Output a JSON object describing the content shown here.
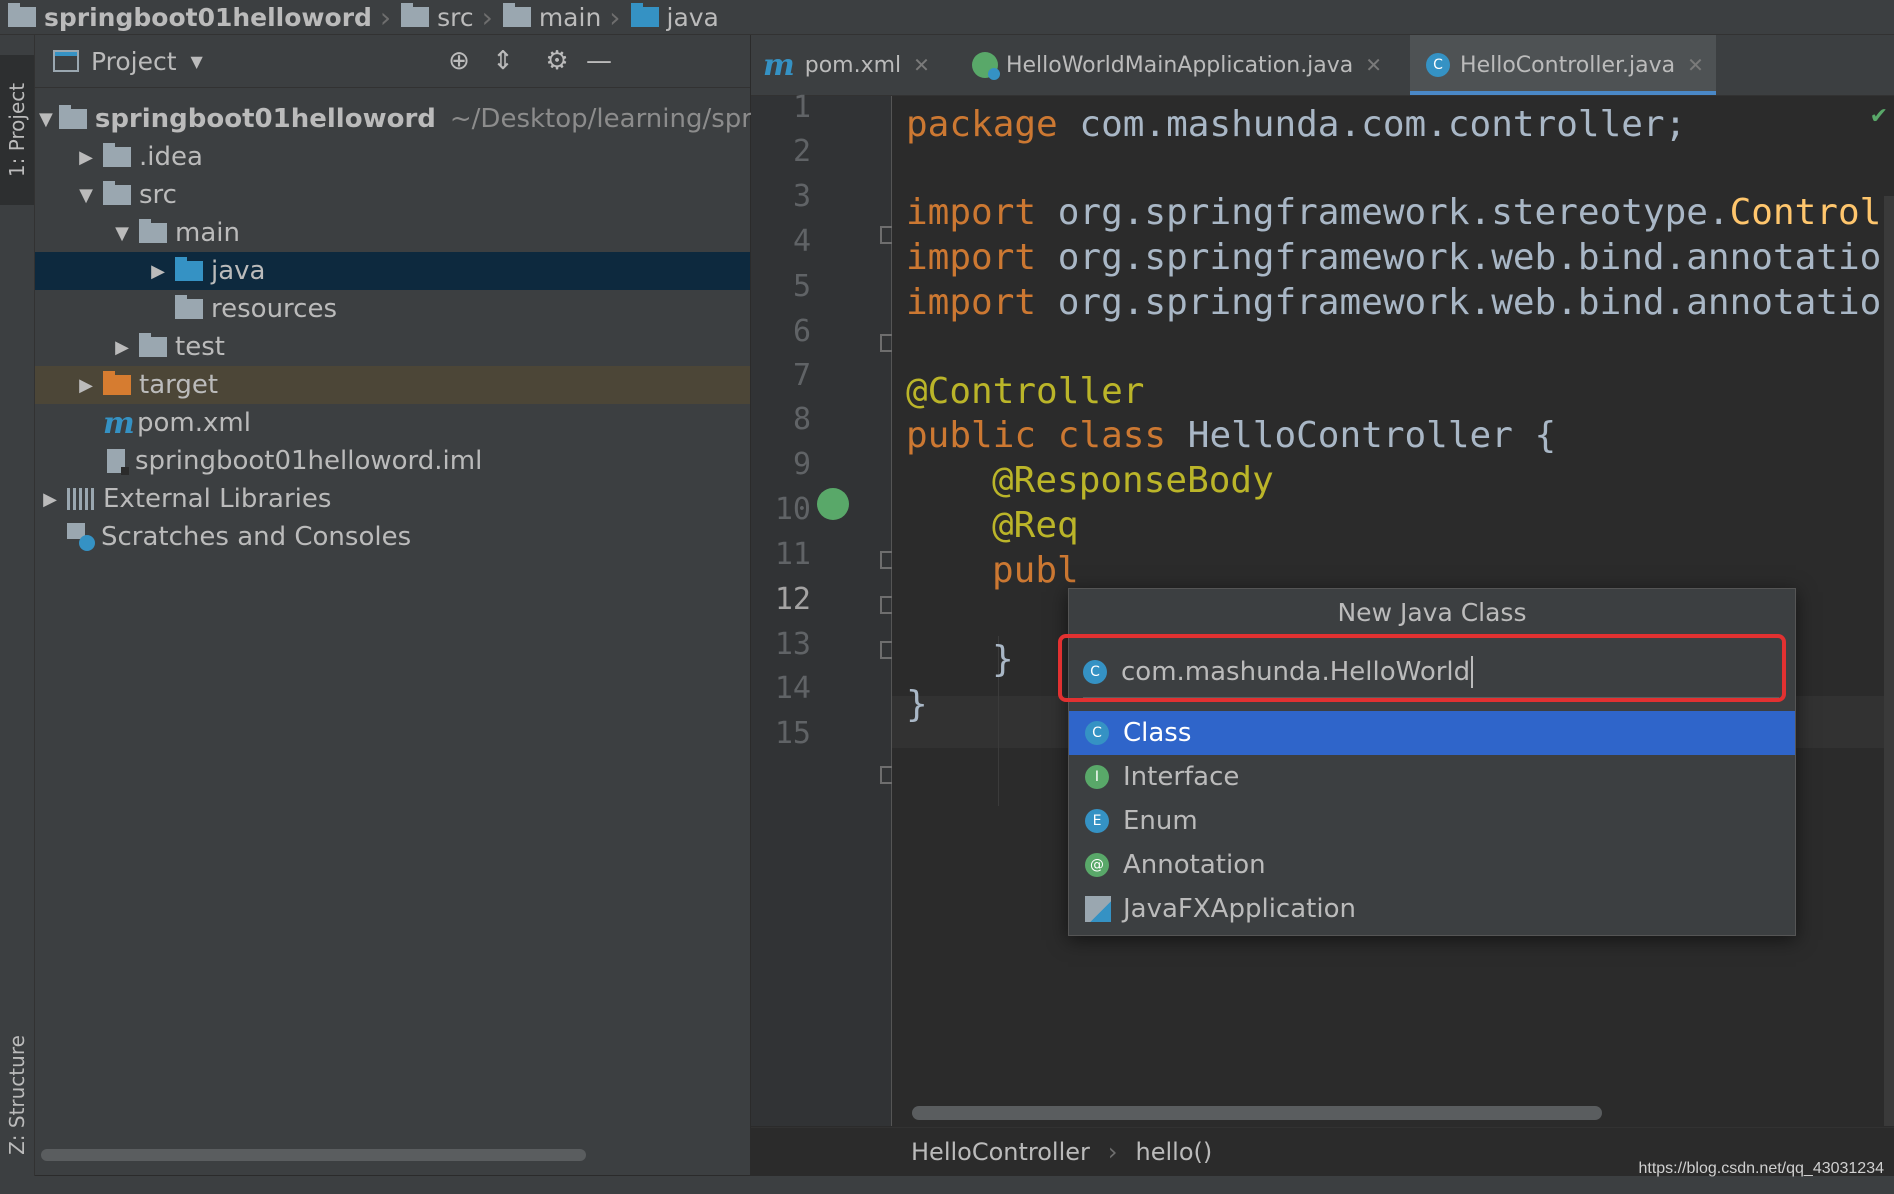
{
  "navbar": {
    "crumbs": [
      "springboot01helloword",
      "src",
      "main",
      "java"
    ]
  },
  "leftstrip": {
    "project_tab": "1: Project",
    "structure_tab": "Z: Structure"
  },
  "project_panel": {
    "title": "Project",
    "tree": [
      {
        "label": "springboot01helloword",
        "path": "~/Desktop/learning/springb",
        "expanded": true
      },
      {
        "label": ".idea",
        "expanded": false
      },
      {
        "label": "src",
        "expanded": true
      },
      {
        "label": "main",
        "expanded": true
      },
      {
        "label": "java",
        "expanded": false,
        "selected": true
      },
      {
        "label": "resources"
      },
      {
        "label": "test",
        "expanded": false
      },
      {
        "label": "target",
        "expanded": false
      },
      {
        "label": "pom.xml"
      },
      {
        "label": "springboot01helloword.iml"
      },
      {
        "label": "External Libraries",
        "expanded": false
      },
      {
        "label": "Scratches and Consoles"
      }
    ]
  },
  "tabs": [
    {
      "label": "pom.xml",
      "icon": "maven-icon"
    },
    {
      "label": "HelloWorldMainApplication.java",
      "icon": "spring-run-icon"
    },
    {
      "label": "HelloController.java",
      "icon": "class-icon",
      "active": true
    }
  ],
  "editor": {
    "line_numbers": [
      "1",
      "2",
      "3",
      "4",
      "5",
      "6",
      "7",
      "8",
      "9",
      "10",
      "11",
      "12",
      "13",
      "14",
      "15"
    ],
    "current_line": "12",
    "lines": {
      "l1_kw": "package",
      "l1_rest": " com.mashunda.com.controller;",
      "l3_kw": "import",
      "l3_pkg": " org.springframework.stereotype.",
      "l3_cls": "Control",
      "l4_kw": "import",
      "l4_pkg": " org.springframework.web.bind.annotatio",
      "l5_kw": "import",
      "l5_pkg": " org.springframework.web.bind.annotatio",
      "l7": "@Controller",
      "l8_kw": "public class",
      "l8_rest": " HelloController {",
      "l9": "@ResponseBody",
      "l10": "@Req",
      "l11": "publ",
      "l13": "}",
      "l14": "}"
    }
  },
  "editor_breadcrumb": [
    "HelloController",
    "hello()"
  ],
  "popup": {
    "title": "New Java Class",
    "input_value": "com.mashunda.HelloWorld",
    "kinds": [
      {
        "label": "Class",
        "badge": "C",
        "color": "#3592c4",
        "selected": true
      },
      {
        "label": "Interface",
        "badge": "I",
        "color": "#59a869"
      },
      {
        "label": "Enum",
        "badge": "E",
        "color": "#3592c4"
      },
      {
        "label": "Annotation",
        "badge": "@",
        "color": "#59a869"
      },
      {
        "label": "JavaFXApplication",
        "badge": "fx"
      }
    ]
  },
  "watermark": "https://blog.csdn.net/qq_43031234"
}
